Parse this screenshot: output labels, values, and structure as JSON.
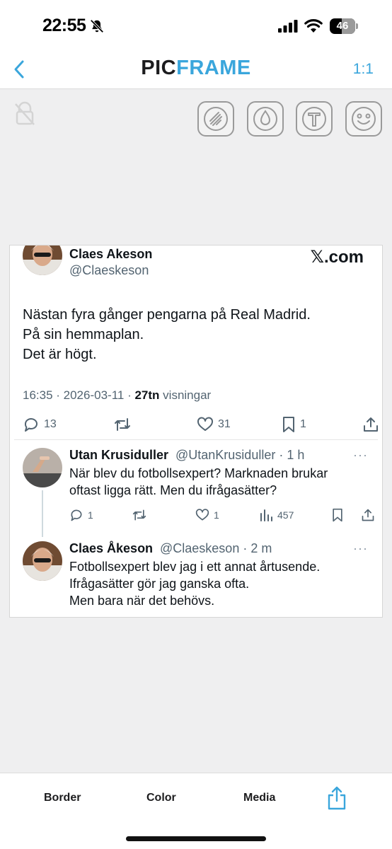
{
  "status_bar": {
    "time": "22:55",
    "battery": "46",
    "battery_level": 0.46
  },
  "header": {
    "title_part1": "PIC",
    "title_part2": "FRAME",
    "ratio": "1:1"
  },
  "toolbar": {
    "tools": [
      "draw-icon",
      "drop-icon",
      "text-icon",
      "smiley-icon"
    ]
  },
  "tweet": {
    "author_name": "Claes Akeson",
    "author_handle": "@Claeskeson",
    "source": "𝕏.com",
    "lines": [
      "Nästan fyra gånger pengarna på Real Madrid.",
      "På sin hemmaplan.",
      "Det är högt."
    ],
    "timestamp": "16:35 · 2026-03-11 · ",
    "views_count": "27tn",
    "views_label": " visningar",
    "replies": "13",
    "likes": "31",
    "bookmarks": "1"
  },
  "reply1": {
    "name": "Utan Krusiduller",
    "handle_time": "@UtanKrusiduller · 1 h",
    "lines": [
      "När blev du fotbollsexpert? Marknaden brukar",
      "oftast ligga rätt. Men du ifrågasätter?"
    ],
    "replies": "1",
    "likes": "1",
    "views": "457"
  },
  "reply2": {
    "name": "Claes Åkeson",
    "handle_time": "@Claeskeson · 2 m",
    "lines": [
      "Fotbollsexpert blev jag i ett annat årtusende.",
      "Ifrågasätter gör jag ganska ofta.",
      "Men bara när det behövs."
    ]
  },
  "bottom_bar": {
    "border": "Border",
    "color": "Color",
    "media": "Media"
  },
  "colors": {
    "accent": "#3aa6dc",
    "text": "#0f1419",
    "muted": "#536471"
  }
}
